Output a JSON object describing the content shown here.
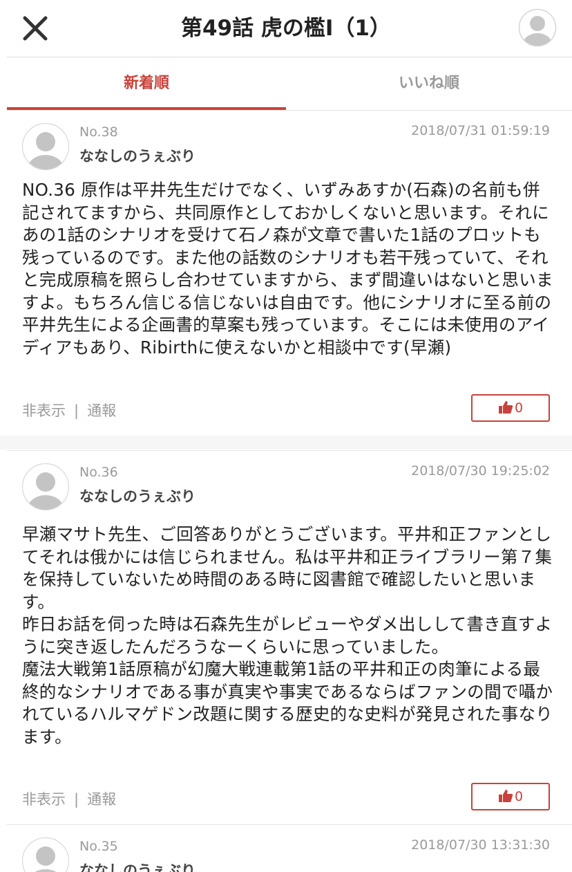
{
  "header": {
    "title": "第49話 虎の檻Ⅰ（1）",
    "close_icon": "close-icon",
    "avatar_icon": "user-avatar-icon"
  },
  "tabs": [
    {
      "label": "新着順",
      "active": true
    },
    {
      "label": "いいね順",
      "active": false
    }
  ],
  "colors": {
    "accent": "#c9413a",
    "muted": "#9a9a9a"
  },
  "comments": [
    {
      "no": "No.38",
      "name": "ななしのうぇぶり",
      "date": "2018/07/31 01:59:19",
      "body": "NO.36 原作は平井先生だけでなく、いずみあすか(石森)の名前も併記されてますから、共同原作としておかしくないと思います。それにあの1話のシナリオを受けて石ノ森が文章で書いた1話のプロットも残っているのです。また他の話数のシナリオも若干残っていて、それと完成原稿を照らし合わせていますから、まず間違いはないと思いますよ。もちろん信じる信じないは自由です。他にシナリオに至る前の平井先生による企画書的草案も残っています。そこには未使用のアイディアもあり、Ribirthに使えないかと相談中です(早瀬)",
      "hide_label": "非表示",
      "report_label": "通報",
      "likes": "0"
    },
    {
      "no": "No.36",
      "name": "ななしのうぇぶり",
      "date": "2018/07/30 19:25:02",
      "body": "早瀬マサト先生、ご回答ありがとうございます。平井和正ファンとしてそれは俄かには信じられません。私は平井和正ライブラリー第７集を保持していないため時間のある時に図書館で確認したいと思います。\n昨日お話を伺った時は石森先生がレビューやダメ出しして書き直すように突き返したんだろうなーくらいに思っていました。\n魔法大戦第1話原稿が幻魔大戦連載第1話の平井和正の肉筆による最終的なシナリオである事が真実や事実であるならばファンの間で囁かれているハルマゲドン改題に関する歴史的な史料が発見された事なります。",
      "hide_label": "非表示",
      "report_label": "通報",
      "likes": "0"
    },
    {
      "no": "No.35",
      "name": "ななしのうぇぶり",
      "date": "2018/07/30 13:31:30"
    }
  ]
}
